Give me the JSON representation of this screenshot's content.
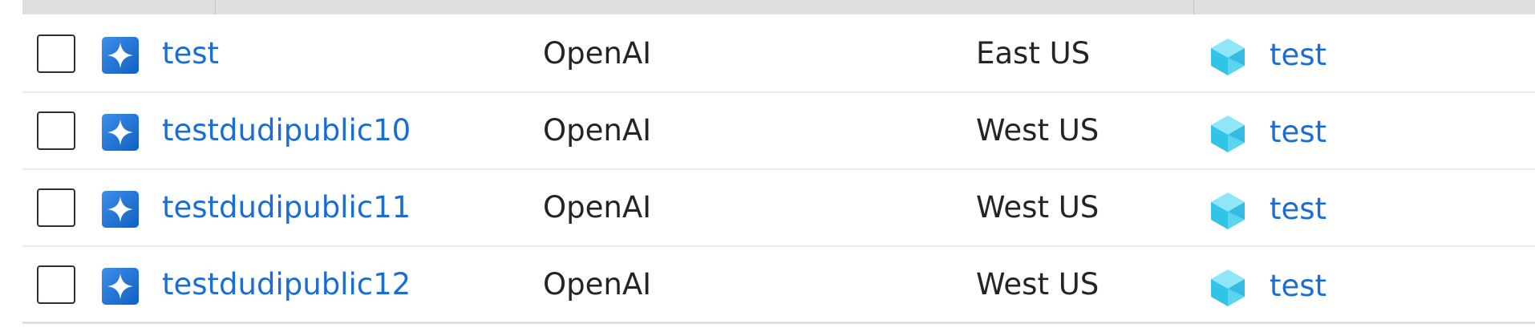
{
  "table": {
    "rows": [
      {
        "name": "test",
        "kind": "OpenAI",
        "location": "East US",
        "resource_group": "test",
        "resource_icon": "openai-sparkle-icon",
        "group_icon": "resource-group-cube-icon"
      },
      {
        "name": "testdudipublic10",
        "kind": "OpenAI",
        "location": "West US",
        "resource_group": "test",
        "resource_icon": "openai-sparkle-icon",
        "group_icon": "resource-group-cube-icon"
      },
      {
        "name": "testdudipublic11",
        "kind": "OpenAI",
        "location": "West US",
        "resource_group": "test",
        "resource_icon": "openai-sparkle-icon",
        "group_icon": "resource-group-cube-icon"
      },
      {
        "name": "testdudipublic12",
        "kind": "OpenAI",
        "location": "West US",
        "resource_group": "test",
        "resource_icon": "openai-sparkle-icon",
        "group_icon": "resource-group-cube-icon"
      }
    ]
  },
  "colors": {
    "link": "#1a6dd4",
    "text": "#242424",
    "header_band": "#e1dfdd",
    "row_divider": "#edebe9"
  }
}
